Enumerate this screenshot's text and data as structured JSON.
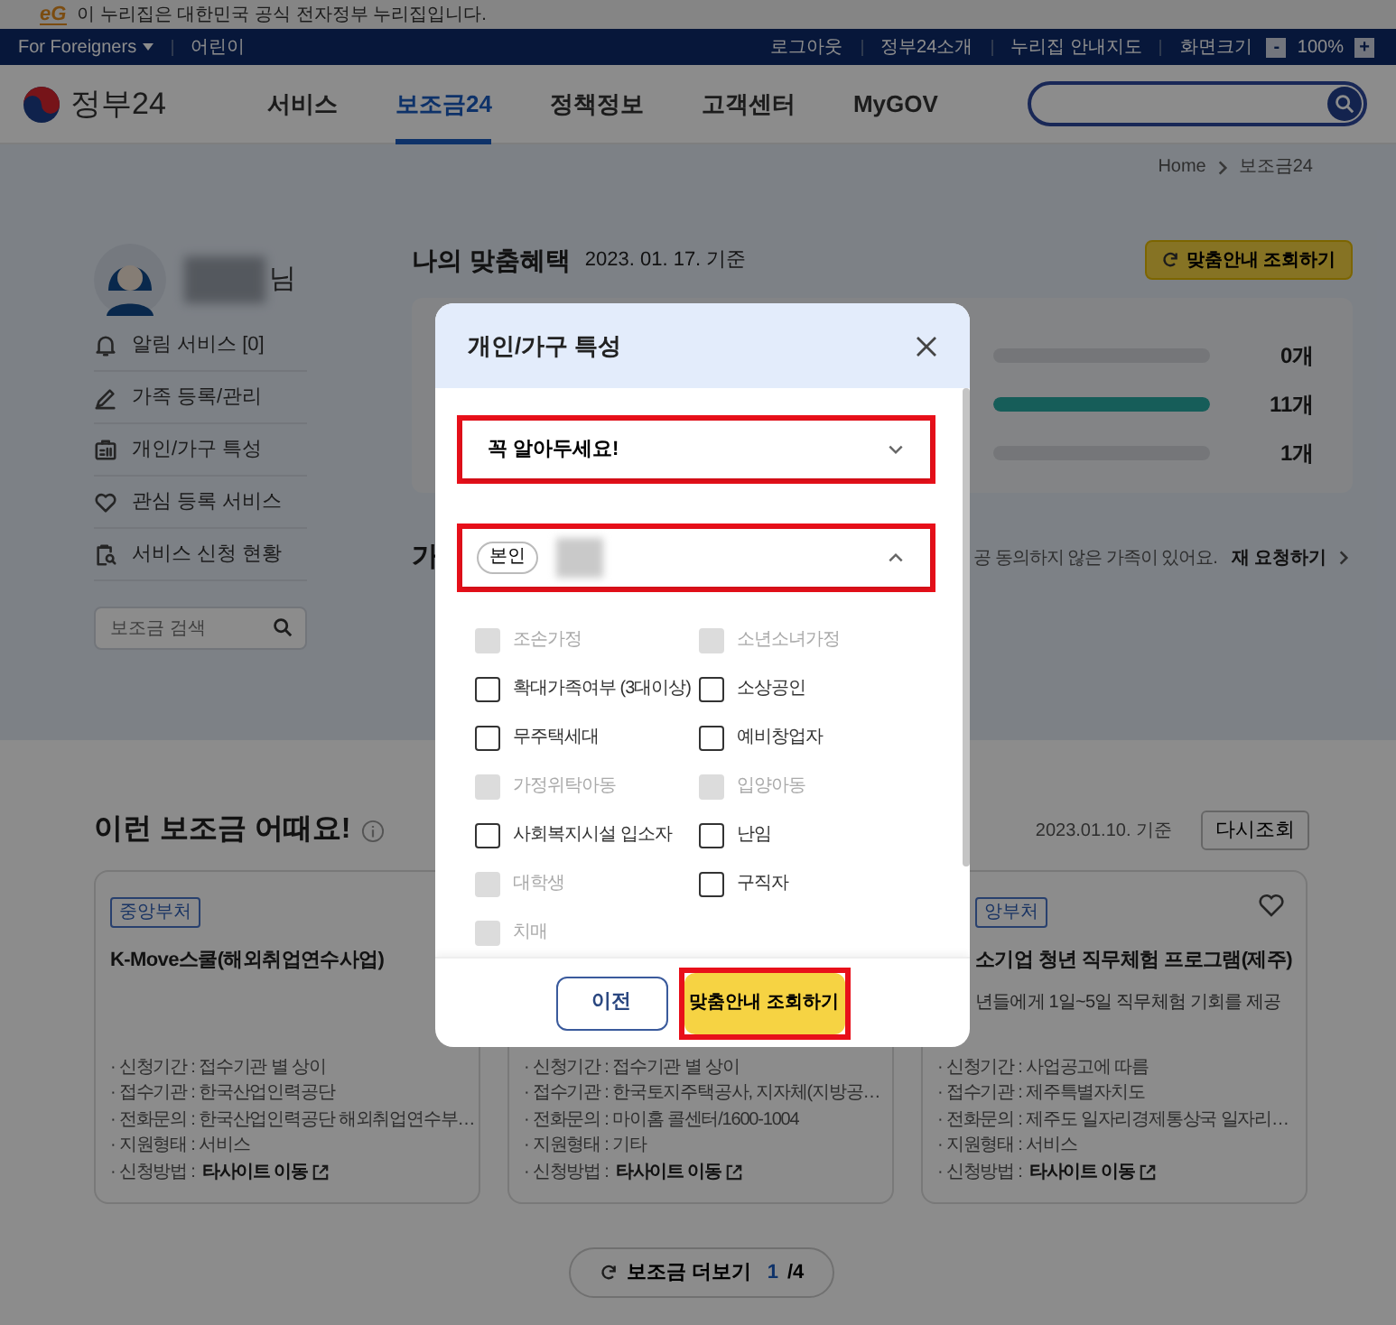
{
  "notice_bar": {
    "logo": "eG",
    "text": "이 누리집은 대한민국 공식 전자정부 누리집입니다."
  },
  "utility_bar": {
    "left": [
      {
        "label": "For Foreigners",
        "has_menu": true
      },
      {
        "label": "어린이",
        "has_menu": false
      }
    ],
    "right": [
      "로그아웃",
      "정부24소개",
      "누리집 안내지도"
    ],
    "zoom": {
      "label": "화면크기",
      "minus": "-",
      "value": "100%",
      "plus": "+"
    }
  },
  "header": {
    "logo": "정부24",
    "nav": [
      {
        "label": "서비스",
        "selected": false
      },
      {
        "label": "보조금24",
        "selected": true
      },
      {
        "label": "정책정보",
        "selected": false
      },
      {
        "label": "고객센터",
        "selected": false
      },
      {
        "label": "MyGOV",
        "selected": false
      }
    ]
  },
  "breadcrumb": [
    "Home",
    "보조금24"
  ],
  "profile": {
    "suffix": "님",
    "menu": [
      "알림 서비스 [0]",
      "가족 등록/관리",
      "개인/가구 특성",
      "관심 등록 서비스",
      "서비스 신청 현황"
    ],
    "search": {
      "placeholder": "보조금 검색"
    }
  },
  "benefits": {
    "title": "나의 맞춤혜택",
    "date": "2023. 01. 17. 기준",
    "button": "맞춤안내 조회하기",
    "bars": [
      {
        "level": 0,
        "count": "0개"
      },
      {
        "level": 1,
        "count": "11개"
      },
      {
        "level": 0,
        "count": "1개"
      }
    ]
  },
  "family": {
    "title": "가",
    "notice": "공 동의하지 않은 가족이 있어요.",
    "link": "재 요청하기"
  },
  "recommend": {
    "title": "이런 보조금 어때요!",
    "date": "2023.01.10. 기준",
    "refresh": "다시조회",
    "cards": [
      {
        "badge": "중앙부처",
        "title": "K-Move스쿨(해외취업연수사업)",
        "rows": [
          {
            "text": "· 신청기간 : 접수기관 별 상이"
          },
          {
            "text": "· 접수기관 : 한국산업인력공단"
          },
          {
            "text": "· 전화문의 : 한국산업인력공단 해외취업연수부…"
          },
          {
            "text": "· 지원형태 : 서비스"
          },
          {
            "text": "· 신청방법 :",
            "link": "타사이트 이동"
          }
        ]
      },
      {
        "rows": [
          {
            "text": "· 신청기간 : 접수기관 별 상이"
          },
          {
            "text": "· 접수기관 : 한국토지주택공사, 지자체(지방공…"
          },
          {
            "text": "· 전화문의 : 마이홈 콜센터/1600-1004"
          },
          {
            "text": "· 지원형태 : 기타"
          },
          {
            "text": "· 신청방법 :",
            "link": "타사이트 이동"
          }
        ]
      },
      {
        "badge": "앙부처",
        "title": "소기업 청년 직무체험 프로그램(제주)",
        "description": "년들에게 1일~5일 직무체험 기회를 제공",
        "favorite": false,
        "rows": [
          {
            "text": "· 신청기간 : 사업공고에 따름"
          },
          {
            "text": "· 접수기관 : 제주특별자치도"
          },
          {
            "text": "· 전화문의 : 제주도 일자리경제통상국 일자리…"
          },
          {
            "text": "· 지원형태 : 서비스"
          },
          {
            "text": "· 신청방법 :",
            "link": "타사이트 이동"
          }
        ]
      }
    ],
    "more": {
      "label": "보조금 더보기",
      "page": "1",
      "total": "/4"
    }
  },
  "modal": {
    "title": "개인/가구 특성",
    "sections": [
      {
        "title": "꼭 알아두세요!",
        "expanded": false,
        "highlighted": true
      },
      {
        "badge": "본인",
        "expanded": true,
        "highlighted": true
      }
    ],
    "options": [
      {
        "label": "조손가정",
        "checked": false,
        "disabled": true
      },
      {
        "label": "소년소녀가정",
        "checked": false,
        "disabled": true
      },
      {
        "label": "확대가족여부 (3대이상)",
        "checked": false,
        "disabled": false
      },
      {
        "label": "소상공인",
        "checked": false,
        "disabled": false
      },
      {
        "label": "무주택세대",
        "checked": false,
        "disabled": false
      },
      {
        "label": "예비창업자",
        "checked": false,
        "disabled": false
      },
      {
        "label": "가정위탁아동",
        "checked": false,
        "disabled": true
      },
      {
        "label": "입양아동",
        "checked": false,
        "disabled": true
      },
      {
        "label": "사회복지시설 입소자",
        "checked": false,
        "disabled": false
      },
      {
        "label": "난임",
        "checked": false,
        "disabled": false
      },
      {
        "label": "대학생",
        "checked": false,
        "disabled": true
      },
      {
        "label": "구직자",
        "checked": false,
        "disabled": false
      },
      {
        "label": "치매",
        "checked": false,
        "disabled": true
      }
    ],
    "buttons": [
      {
        "label": "이전",
        "kind": "secondary",
        "highlighted": false
      },
      {
        "label": "맞춤안내 조회하기",
        "kind": "primary",
        "highlighted": true
      }
    ]
  }
}
